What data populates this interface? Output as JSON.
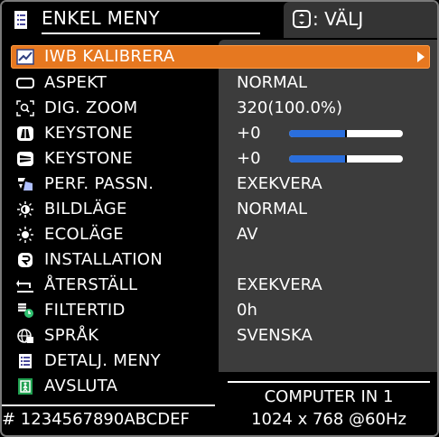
{
  "header": {
    "title": "ENKEL MENY",
    "hint_text": ": VÄLJ",
    "title_icon": "menu-list-icon",
    "hint_icon": "select-dpad-icon"
  },
  "menu": {
    "items": [
      {
        "label": "IWB KALIBRERA",
        "value": "",
        "icon": "iwb-calibrate-icon",
        "selected": true
      },
      {
        "label": "ASPEKT",
        "value": "NORMAL",
        "icon": "aspect-icon"
      },
      {
        "label": "DIG. ZOOM",
        "value": "320(100.0%)",
        "icon": "digital-zoom-icon"
      },
      {
        "label": "KEYSTONE",
        "value": "+0",
        "icon": "keystone-vertical-icon",
        "slider": 0.5
      },
      {
        "label": "KEYSTONE",
        "value": "+0",
        "icon": "keystone-horizontal-icon",
        "slider": 0.5
      },
      {
        "label": "PERF. PASSN.",
        "value": "EXEKVERA",
        "icon": "perfect-fit-icon"
      },
      {
        "label": "BILDLÄGE",
        "value": "NORMAL",
        "icon": "picture-mode-icon"
      },
      {
        "label": "ECOLÄGE",
        "value": "AV",
        "icon": "eco-mode-icon"
      },
      {
        "label": "INSTALLATION",
        "value": "",
        "icon": "installation-icon"
      },
      {
        "label": "ÅTERSTÄLL",
        "value": "EXEKVERA",
        "icon": "reset-icon"
      },
      {
        "label": "FILTERTID",
        "value": "0h",
        "icon": "filter-time-icon"
      },
      {
        "label": "SPRÅK",
        "value": "SVENSKA",
        "icon": "language-icon"
      },
      {
        "label": "DETALJ. MENY",
        "value": "",
        "icon": "advanced-menu-icon"
      },
      {
        "label": "AVSLUTA",
        "value": "",
        "icon": "exit-icon"
      }
    ]
  },
  "footer": {
    "serial": "# 1234567890ABCDEF",
    "source": "COMPUTER IN 1",
    "resolution": "1024 x 768 @60Hz"
  },
  "colors": {
    "accent": "#e67820",
    "panel": "#3c3c3c",
    "slider_fill": "#2a6edc"
  }
}
